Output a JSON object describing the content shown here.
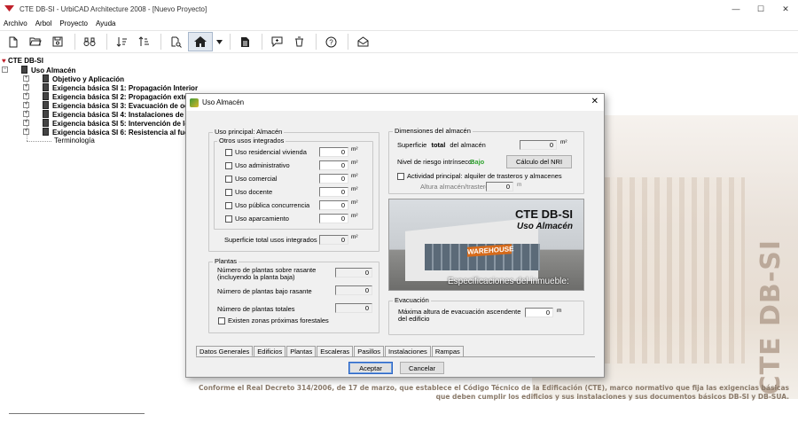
{
  "window": {
    "title": "CTE DB-SI - UrbiCAD Architecture 2008 - [Nuevo Proyecto]",
    "minimize": "—",
    "maximize": "☐",
    "close": "✕"
  },
  "menu": [
    "Archivo",
    "Arbol",
    "Proyecto",
    "Ayuda"
  ],
  "toolbar": {
    "icons": [
      "new-file-icon",
      "open-folder-icon",
      "save-icon",
      "binoculars-icon",
      "sort-descending-icon",
      "sort-ascending-icon",
      "search-document-icon",
      "home-icon",
      "dropdown-arrow-icon",
      "document-icon",
      "comment-icon",
      "trash-icon",
      "help-icon",
      "mail-icon"
    ]
  },
  "tree": {
    "root": "CTE DB-SI",
    "uso": "Uso Almacén",
    "items": [
      "Objetivo y Aplicación",
      "Exigencia básica SI 1: Propagación Interior",
      "Exigencia básica SI 2: Propagación exter",
      "Exigencia básica SI 3: Evacuación de oc",
      "Exigencia básica SI 4: Instalaciones de p",
      "Exigencia básica SI 5: Intervención de lo",
      "Exigencia básica SI 6: Resistencia al fue"
    ],
    "terminologia": "Terminología"
  },
  "background": {
    "vertical_text": "CTE DB-SI",
    "caption_line1": "Conforme el Real Decreto 314/2006, de 17 de marzo, que establece el Código Técnico de la Edificación (CTE), marco normativo que fija las exigencias básicas",
    "caption_line2": "que deben cumplir los edificios y sus instalaciones y sus documentos básicos DB-SI y DB-SUA."
  },
  "dialog": {
    "title": "Uso Almacén",
    "close": "✕",
    "uso_principal": {
      "title": "Uso principal: Almacén",
      "otros_title": "Otros usos integrados",
      "rows": [
        {
          "label": "Uso residencial vivienda",
          "value": "0",
          "unit": "m²"
        },
        {
          "label": "Uso administrativo",
          "value": "0",
          "unit": "m²"
        },
        {
          "label": "Uso comercial",
          "value": "0",
          "unit": "m²"
        },
        {
          "label": "Uso docente",
          "value": "0",
          "unit": "m²"
        },
        {
          "label": "Uso pública concurrencia",
          "value": "0",
          "unit": "m²"
        },
        {
          "label": "Uso aparcamiento",
          "value": "0",
          "unit": "m²"
        }
      ],
      "total_label": "Superficie total usos integrados",
      "total_value": "0",
      "total_unit": "m²"
    },
    "plantas": {
      "title": "Plantas",
      "sobre_label_1": "Número de plantas sobre rasante",
      "sobre_label_2": "(incluyendo la planta baja)",
      "sobre_value": "0",
      "bajo_label": "Número de plantas bajo rasante",
      "bajo_value": "0",
      "totales_label": "Número de plantas totales",
      "totales_value": "0",
      "forestales_label": "Existen zonas próximas forestales"
    },
    "dimensiones": {
      "title": "Dimensiones del almacén",
      "superficie_pre": "Superficie",
      "superficie_bold": "total",
      "superficie_post": "del almacén",
      "superficie_value": "0",
      "superficie_unit": "m²",
      "riesgo_label": "Nivel de riesgo intrínseco:",
      "riesgo_value": "Bajo",
      "riesgo_color": "#2fa32f",
      "calculo_button": "Cálculo del NRI",
      "actividad_label": "Actividad principal: alquiler de trasteros y almacenes",
      "altura_label": "Altura almacén/trastero",
      "altura_value": "0",
      "altura_unit": "m"
    },
    "image": {
      "heading": "CTE DB-SI",
      "subheading": "Uso Almacén",
      "sign": "WAREHOUSE",
      "footer": "Especificaciones del inmueble:"
    },
    "evacuacion": {
      "title": "Evacuación",
      "label_1": "Máxima altura de evacuación ascendente",
      "label_2": "del edificio",
      "value": "0",
      "unit": "m"
    },
    "tabs": [
      "Datos Generales",
      "Edificios",
      "Plantas",
      "Escaleras",
      "Pasillos",
      "Instalaciones",
      "Rampas"
    ],
    "active_tab": "Datos Generales",
    "aceptar": "Aceptar",
    "cancelar": "Cancelar"
  }
}
